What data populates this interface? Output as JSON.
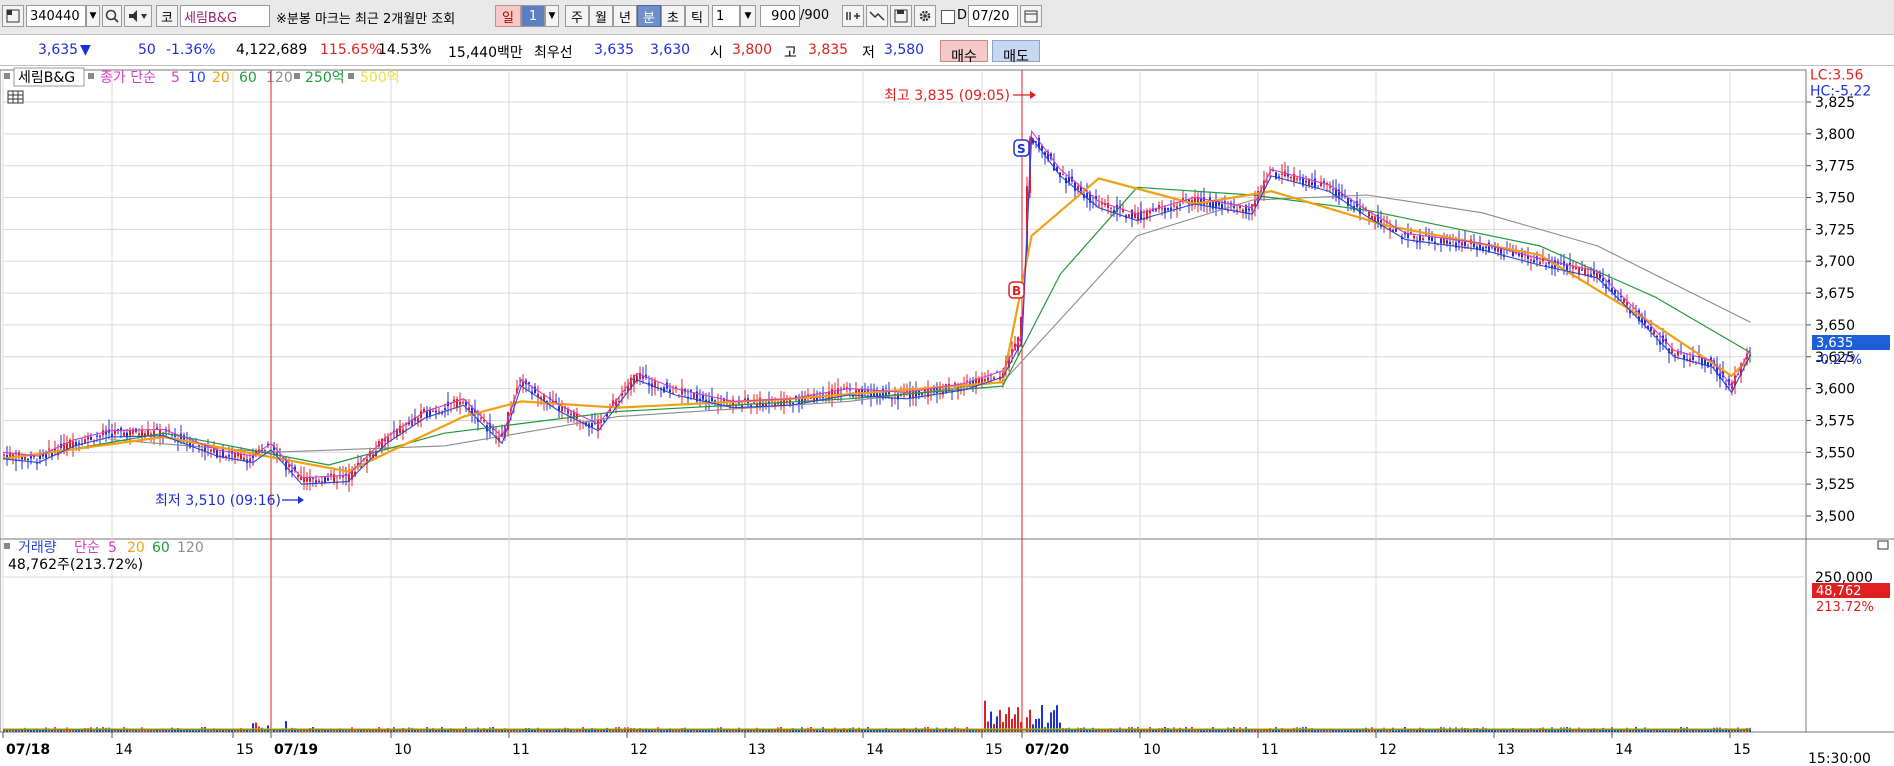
{
  "toolbar": {
    "code": "340440",
    "market_tag": "코",
    "name": "세림B&G",
    "notice": "※분봉 마크는 최근 2개월만 조회",
    "period_day": "일",
    "period_day_n": "1",
    "period_week": "주",
    "period_month": "월",
    "period_year": "년",
    "period_min": "분",
    "period_sec": "초",
    "period_tick": "틱",
    "interval": "1",
    "count": "900",
    "count_total": "/900",
    "date_checkbox_label": "D",
    "date_value": "07/20"
  },
  "quote": {
    "price": "3,635",
    "change_arrow": "▼",
    "change": "50",
    "change_pct": "-1.36%",
    "volume": "4,122,689",
    "vol_ratio": "115.65%",
    "turnover": "14.53%",
    "amount": "15,440백만",
    "best_label": "최우선",
    "best_ask": "3,635",
    "best_bid": "3,630",
    "open_label": "시",
    "open": "3,800",
    "high_label": "고",
    "high": "3,835",
    "low_label": "저",
    "low": "3,580",
    "buy_label": "매수",
    "sell_label": "매도"
  },
  "legend": {
    "name": "세림B&G",
    "ma_label": "종가 단순",
    "ma_periods": [
      "5",
      "10",
      "20",
      "60",
      "120"
    ],
    "amt1": "250억",
    "amt2": "500억"
  },
  "volume_legend": {
    "label": "거래량",
    "ma_label": "단순",
    "periods": [
      "5",
      "20",
      "60",
      "120"
    ],
    "last": "48,762주(213.72%)"
  },
  "right_labels": {
    "lc": "LC:3.56",
    "hc": "HC:-5.22",
    "current_price": "3,635",
    "current_pct": "-0.27%",
    "vol_value": "48,762",
    "vol_pct": "213.72%"
  },
  "x_axis": {
    "labels": [
      "07/18",
      "14",
      "15",
      "07/19",
      "10",
      "11",
      "12",
      "13",
      "14",
      "15",
      "07/20",
      "10",
      "11",
      "12",
      "13",
      "14",
      "15"
    ],
    "time": "15:30:00"
  },
  "colors": {
    "up": "#e02020",
    "down": "#1d2fd8",
    "ma5": "#d63cc8",
    "ma10": "#2d43d9",
    "ma20": "#f0a010",
    "ma60": "#1f9a3a",
    "ma120": "#8c8c8c"
  },
  "chart_data": {
    "type": "candlestick",
    "x_labels": [
      "07/18",
      "14",
      "15",
      "07/19",
      "10",
      "11",
      "12",
      "13",
      "14",
      "15",
      "07/20",
      "10",
      "11",
      "12",
      "13",
      "14",
      "15"
    ],
    "ylim": [
      3480,
      3850
    ],
    "y_ticks": [
      3500,
      3525,
      3550,
      3575,
      3600,
      3625,
      3650,
      3675,
      3700,
      3725,
      3750,
      3775,
      3800,
      3825
    ],
    "annotations": [
      {
        "text": "최고 3,835 (09:05)",
        "x": "07/20 09:05",
        "y": 3835
      },
      {
        "text": "최저 3,510 (09:16)",
        "x": "07/19 09:16",
        "y": 3510
      }
    ],
    "signals": [
      {
        "type": "B",
        "x": "07/20 09:02",
        "y": 3680
      },
      {
        "type": "S",
        "x": "07/20 09:05",
        "y": 3790
      }
    ],
    "price_path": [
      {
        "t": "07/18 13:00",
        "v": 3548
      },
      {
        "t": "07/18 13:20",
        "v": 3545
      },
      {
        "t": "07/18 13:40",
        "v": 3558
      },
      {
        "t": "07/18 14:00",
        "v": 3565
      },
      {
        "t": "07/18 14:30",
        "v": 3566
      },
      {
        "t": "07/18 15:00",
        "v": 3550
      },
      {
        "t": "07/18 15:20",
        "v": 3545
      },
      {
        "t": "07/19 09:00",
        "v": 3555
      },
      {
        "t": "07/19 09:16",
        "v": 3528
      },
      {
        "t": "07/19 09:40",
        "v": 3530
      },
      {
        "t": "07/19 10:00",
        "v": 3560
      },
      {
        "t": "07/19 10:20",
        "v": 3580
      },
      {
        "t": "07/19 10:40",
        "v": 3590
      },
      {
        "t": "07/19 11:00",
        "v": 3560
      },
      {
        "t": "07/19 11:10",
        "v": 3605
      },
      {
        "t": "07/19 11:30",
        "v": 3585
      },
      {
        "t": "07/19 11:50",
        "v": 3570
      },
      {
        "t": "07/19 12:10",
        "v": 3610
      },
      {
        "t": "07/19 12:30",
        "v": 3598
      },
      {
        "t": "07/19 13:00",
        "v": 3588
      },
      {
        "t": "07/19 13:30",
        "v": 3590
      },
      {
        "t": "07/19 14:00",
        "v": 3598
      },
      {
        "t": "07/19 14:30",
        "v": 3595
      },
      {
        "t": "07/19 15:00",
        "v": 3602
      },
      {
        "t": "07/19 15:20",
        "v": 3612
      },
      {
        "t": "07/20 09:00",
        "v": 3640
      },
      {
        "t": "07/20 09:05",
        "v": 3800
      },
      {
        "t": "07/20 09:20",
        "v": 3770
      },
      {
        "t": "07/20 09:40",
        "v": 3745
      },
      {
        "t": "07/20 10:00",
        "v": 3735
      },
      {
        "t": "07/20 10:30",
        "v": 3748
      },
      {
        "t": "07/20 11:00",
        "v": 3740
      },
      {
        "t": "07/20 11:10",
        "v": 3770
      },
      {
        "t": "07/20 11:40",
        "v": 3758
      },
      {
        "t": "07/20 12:00",
        "v": 3738
      },
      {
        "t": "07/20 12:20",
        "v": 3720
      },
      {
        "t": "07/20 13:00",
        "v": 3712
      },
      {
        "t": "07/20 13:30",
        "v": 3700
      },
      {
        "t": "07/20 14:00",
        "v": 3690
      },
      {
        "t": "07/20 14:20",
        "v": 3660
      },
      {
        "t": "07/20 14:40",
        "v": 3628
      },
      {
        "t": "07/20 15:00",
        "v": 3620
      },
      {
        "t": "07/20 15:10",
        "v": 3600
      },
      {
        "t": "07/20 15:20",
        "v": 3630
      }
    ],
    "ma_paths": {
      "ma20": [
        {
          "t": "07/18 13:00",
          "v": 3545
        },
        {
          "t": "07/18 14:30",
          "v": 3562
        },
        {
          "t": "07/19 09:40",
          "v": 3535
        },
        {
          "t": "07/19 10:40",
          "v": 3578
        },
        {
          "t": "07/19 11:10",
          "v": 3590
        },
        {
          "t": "07/19 12:00",
          "v": 3585
        },
        {
          "t": "07/19 13:30",
          "v": 3592
        },
        {
          "t": "07/19 15:20",
          "v": 3605
        },
        {
          "t": "07/20 09:05",
          "v": 3720
        },
        {
          "t": "07/20 09:40",
          "v": 3765
        },
        {
          "t": "07/20 10:30",
          "v": 3745
        },
        {
          "t": "07/20 11:10",
          "v": 3755
        },
        {
          "t": "07/20 12:10",
          "v": 3728
        },
        {
          "t": "07/20 13:30",
          "v": 3705
        },
        {
          "t": "07/20 14:30",
          "v": 3650
        },
        {
          "t": "07/20 15:10",
          "v": 3610
        },
        {
          "t": "07/20 15:20",
          "v": 3625
        }
      ],
      "ma60": [
        {
          "t": "07/18 13:20",
          "v": 3548
        },
        {
          "t": "07/18 14:30",
          "v": 3565
        },
        {
          "t": "07/19 09:30",
          "v": 3540
        },
        {
          "t": "07/19 10:30",
          "v": 3565
        },
        {
          "t": "07/19 12:00",
          "v": 3582
        },
        {
          "t": "07/19 14:00",
          "v": 3592
        },
        {
          "t": "07/19 15:20",
          "v": 3602
        },
        {
          "t": "07/20 09:20",
          "v": 3690
        },
        {
          "t": "07/20 10:00",
          "v": 3758
        },
        {
          "t": "07/20 11:00",
          "v": 3752
        },
        {
          "t": "07/20 12:00",
          "v": 3740
        },
        {
          "t": "07/20 13:30",
          "v": 3712
        },
        {
          "t": "07/20 14:30",
          "v": 3672
        },
        {
          "t": "07/20 15:20",
          "v": 3628
        }
      ],
      "ma120": [
        {
          "t": "07/18 14:00",
          "v": 3560
        },
        {
          "t": "07/19 09:00",
          "v": 3550
        },
        {
          "t": "07/19 10:30",
          "v": 3555
        },
        {
          "t": "07/19 12:00",
          "v": 3578
        },
        {
          "t": "07/19 14:00",
          "v": 3590
        },
        {
          "t": "07/19 15:20",
          "v": 3605
        },
        {
          "t": "07/20 10:00",
          "v": 3720
        },
        {
          "t": "07/20 11:00",
          "v": 3748
        },
        {
          "t": "07/20 12:00",
          "v": 3752
        },
        {
          "t": "07/20 13:00",
          "v": 3738
        },
        {
          "t": "07/20 14:00",
          "v": 3712
        },
        {
          "t": "07/20 15:20",
          "v": 3652
        }
      ]
    },
    "volume": {
      "ylim": [
        0,
        300000
      ],
      "y_ticks": [
        250000
      ],
      "last": 48762
    }
  }
}
